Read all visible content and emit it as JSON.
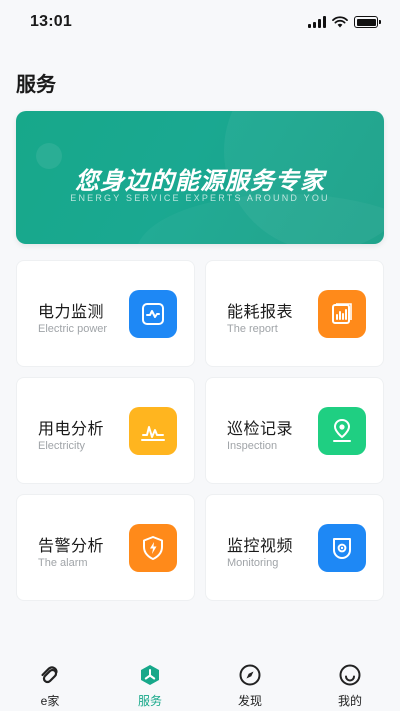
{
  "status_bar": {
    "time": "13:01"
  },
  "page": {
    "title": "服务"
  },
  "banner": {
    "title": "您身边的能源服务专家",
    "subtitle": "ENERGY SERVICE EXPERTS AROUND YOU"
  },
  "services": [
    {
      "title": "电力监测",
      "subtitle": "Electric power",
      "icon": "monitor-wave-icon",
      "color": "#1e88f5"
    },
    {
      "title": "能耗报表",
      "subtitle": "The report",
      "icon": "report-chart-icon",
      "color": "#ff8a1a"
    },
    {
      "title": "用电分析",
      "subtitle": "Electricity",
      "icon": "analysis-chart-icon",
      "color": "#ffb51f"
    },
    {
      "title": "巡检记录",
      "subtitle": "Inspection",
      "icon": "location-pin-icon",
      "color": "#1fcf82"
    },
    {
      "title": "告警分析",
      "subtitle": "The alarm",
      "icon": "shield-lightning-icon",
      "color": "#ff8a1a"
    },
    {
      "title": "监控视频",
      "subtitle": "Monitoring",
      "icon": "camera-icon",
      "color": "#1e88f5"
    }
  ],
  "tabbar": {
    "items": [
      {
        "label": "e家",
        "icon": "home-link-icon"
      },
      {
        "label": "服务",
        "icon": "service-hex-icon",
        "active": true
      },
      {
        "label": "发现",
        "icon": "compass-icon"
      },
      {
        "label": "我的",
        "icon": "profile-smile-icon"
      }
    ]
  },
  "colors": {
    "accent": "#17a88a"
  }
}
